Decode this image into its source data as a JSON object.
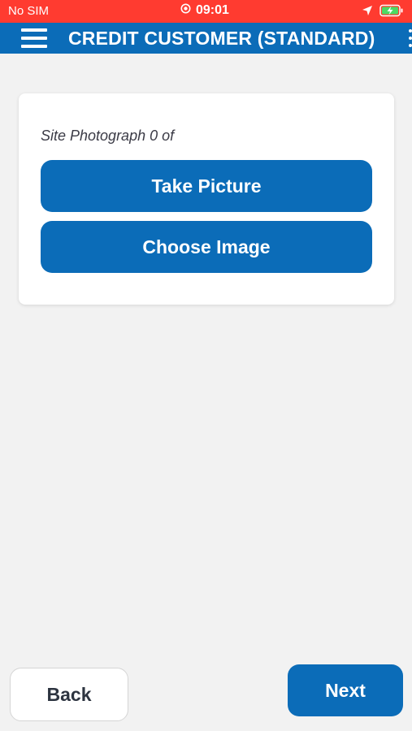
{
  "status_bar": {
    "carrier": "No SIM",
    "time": "09:01",
    "icons": [
      "alarm-icon",
      "location-arrow-icon",
      "battery-charging-icon"
    ],
    "background": "#ff3b30"
  },
  "header": {
    "title": "CREDIT CUSTOMER (STANDARD)",
    "menu_icon": "hamburger-menu-icon",
    "more_icon": "more-vertical-icon",
    "background": "#0b6cb8"
  },
  "card": {
    "photo_label": "Site Photograph 0 of",
    "take_picture_label": "Take Picture",
    "choose_image_label": "Choose Image"
  },
  "footer": {
    "back_label": "Back",
    "next_label": "Next"
  },
  "colors": {
    "accent": "#0b6cb8",
    "background": "#f2f2f2",
    "status_bar": "#ff3b30"
  }
}
